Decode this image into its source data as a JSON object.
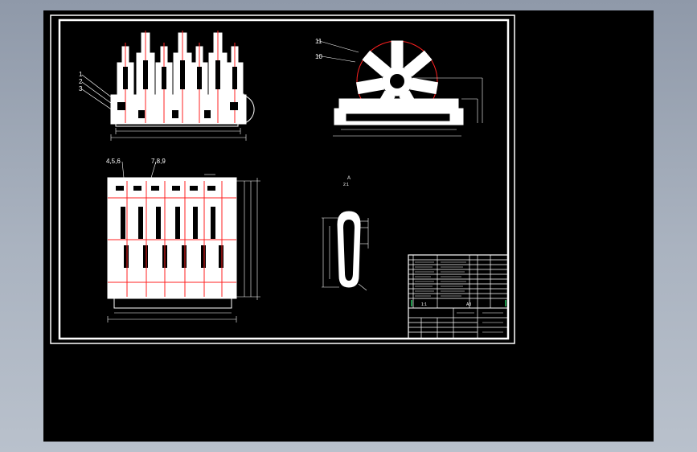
{
  "view": {
    "background": "#000000",
    "line_color": "#ffffff",
    "accent_color": "#ff2020",
    "highlight_color": "#22c55e"
  },
  "labels": {
    "callout_1": "1",
    "callout_2": "2",
    "callout_3": "3",
    "callout_A": "A",
    "callout_11": "11",
    "callout_10": "10",
    "callout_456": "4,5,6",
    "callout_789": "7,8,9",
    "detail_A": "A",
    "detail_scale": "2:1"
  },
  "title_block": {
    "row_left": "1:1",
    "row_mid": "A3"
  }
}
